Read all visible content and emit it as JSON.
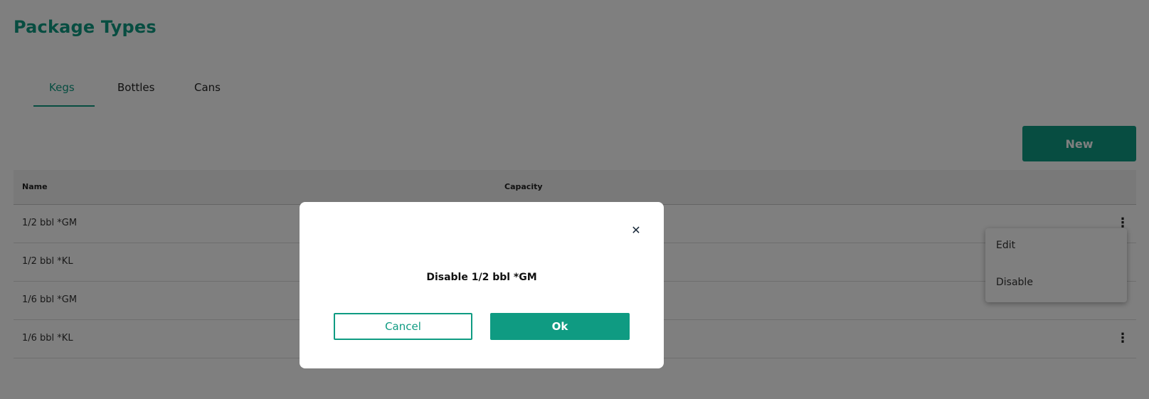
{
  "page": {
    "title": "Package Types"
  },
  "tabs": [
    {
      "label": "Kegs",
      "active": true
    },
    {
      "label": "Bottles",
      "active": false
    },
    {
      "label": "Cans",
      "active": false
    }
  ],
  "toolbar": {
    "new_label": "New"
  },
  "table": {
    "columns": [
      "Name",
      "Capacity"
    ],
    "rows": [
      {
        "name": "1/2 bbl *GM",
        "capacity": ""
      },
      {
        "name": "1/2 bbl *KL",
        "capacity": ""
      },
      {
        "name": "1/6 bbl *GM",
        "capacity": ""
      },
      {
        "name": "1/6 bbl *KL",
        "capacity": ""
      }
    ]
  },
  "context_menu": {
    "items": [
      "Edit",
      "Disable"
    ]
  },
  "modal": {
    "message": "Disable 1/2 bbl *GM",
    "cancel_label": "Cancel",
    "ok_label": "Ok"
  },
  "icons": {
    "kebab": "vertical-ellipsis",
    "close": "x"
  },
  "colors": {
    "accent": "#0f9b82",
    "overlay": "rgba(0,0,0,0.5)"
  }
}
